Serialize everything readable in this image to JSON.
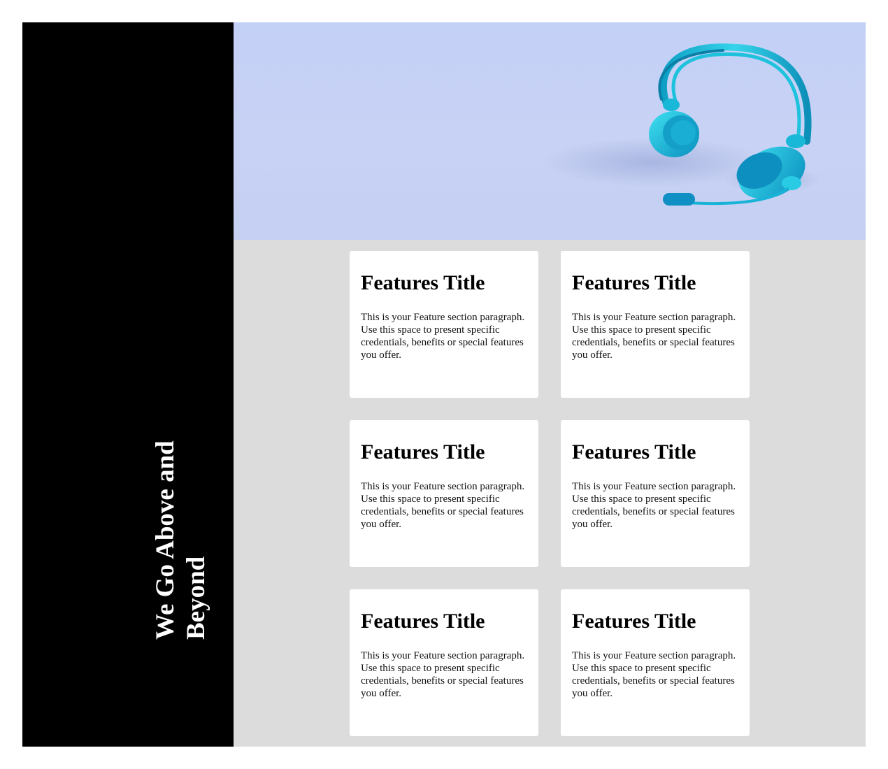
{
  "sidebar": {
    "heading": "We Go Above and Beyond"
  },
  "hero": {
    "image": "headset-icon",
    "background_color": "#c5d1f7",
    "accent_color": "#1cc3dc"
  },
  "features": [
    {
      "title": "Features Title",
      "text": "This is your Feature section paragraph. Use this space to present specific credentials, benefits or special features you offer."
    },
    {
      "title": "Features Title",
      "text": "This is your Feature section paragraph. Use this space to present specific credentials, benefits or special features you offer."
    },
    {
      "title": "Features Title",
      "text": "This is your Feature section paragraph. Use this space to present specific credentials, benefits or special features you offer."
    },
    {
      "title": "Features Title",
      "text": "This is your Feature section paragraph. Use this space to present specific credentials, benefits or special features you offer."
    },
    {
      "title": "Features Title",
      "text": "This is your Feature section paragraph. Use this space to present specific credentials, benefits or special features you offer."
    },
    {
      "title": "Features Title",
      "text": "This is your Feature section paragraph. Use this space to present specific credentials, benefits or special features you offer."
    }
  ]
}
